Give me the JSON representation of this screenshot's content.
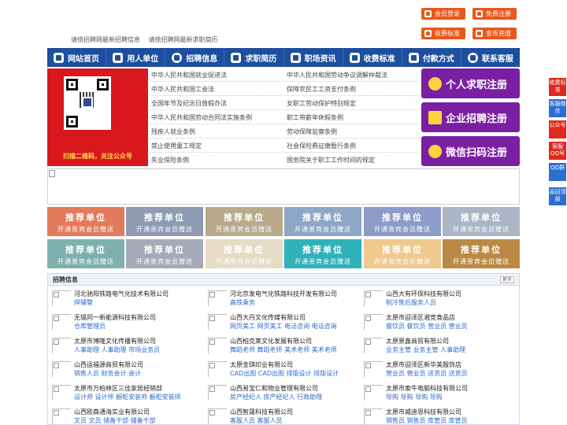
{
  "top": {
    "notices": [
      "请徐招聘网最新招聘信息",
      "请徐招聘网最新求职简历"
    ],
    "buttons": [
      {
        "label": "会员登录",
        "icon": "user-icon"
      },
      {
        "label": "免费注册",
        "icon": "register-icon"
      },
      {
        "label": "收费标准",
        "icon": "price-icon"
      },
      {
        "label": "金币充值",
        "icon": "coin-icon"
      }
    ]
  },
  "nav": [
    {
      "label": "网站首页",
      "icon": "home-icon"
    },
    {
      "label": "用人单位",
      "icon": "building-icon"
    },
    {
      "label": "招聘信息",
      "icon": "recruit-icon"
    },
    {
      "label": "求职简历",
      "icon": "resume-icon"
    },
    {
      "label": "职场资讯",
      "icon": "news-icon"
    },
    {
      "label": "收费标准",
      "icon": "price-icon"
    },
    {
      "label": "付款方式",
      "icon": "payment-icon"
    },
    {
      "label": "联系客服",
      "icon": "service-icon"
    }
  ],
  "qr": {
    "caption": "扫描二维码，关注公众号"
  },
  "links": {
    "left": [
      "中华人民共和国就业促进法",
      "中华人民共和国工会法",
      "全国年节及纪念日放假办法",
      "中华人民共和国劳动合同法实施条例",
      "残疾人就业条例",
      "禁止使用童工规定",
      "失业保险条例"
    ],
    "right": [
      "中华人民共和国劳动争议调解仲裁法",
      "保障农民工工资支付条例",
      "女职工劳动保护特别规定",
      "职工带薪年休假条例",
      "劳动保障监察条例",
      "社会保险费征缴暂行条例",
      "国务院关于职工工作时间的规定"
    ]
  },
  "register": [
    {
      "label": "个人求职注册",
      "icon": "person-icon"
    },
    {
      "label": "企业招聘注册",
      "icon": "company-icon"
    },
    {
      "label": "微信扫码注册",
      "icon": "wechat-icon"
    }
  ],
  "tiles": {
    "title": "推荐单位",
    "subtitle": "开通贵宾会员赠送",
    "colors": [
      "#e27b5b",
      "#8e9bb3",
      "#b9aa8c",
      "#8ea7c7",
      "#8d9bc8",
      "#aab6c6",
      "#7fb0b0",
      "#a5a9b9",
      "#e6dcc6",
      "#2fb2ba",
      "#f0c98f",
      "#ba8a44",
      "#b7b2a4"
    ]
  },
  "jobs": {
    "title": "招聘信息",
    "more": "更多",
    "items": [
      {
        "company": "河北驰阳铁路电气化技术有限公司",
        "positions": "焊辅警"
      },
      {
        "company": "河北京发电气化铁路科技开发有限公司",
        "positions": "高铁乘务"
      },
      {
        "company": "山西大有环保科技有限公司",
        "positions": "制冷售后服务人员"
      },
      {
        "company": "无锡同一新能源科技有限公司",
        "positions": "仓库管理员"
      },
      {
        "company": "山西大丹文化传媒有限公司",
        "positions": "网页美工 网页美工 电话咨询 电话咨询"
      },
      {
        "company": "太原市迎泽区湘竞食品店",
        "positions": "餐饮员 餐饮员 营业员 营业员"
      },
      {
        "company": "太原市博隆文化传播有限公司",
        "positions": "人事助理 人事助理 市场业务员"
      },
      {
        "company": "山西柏克莱文化发展有限公司",
        "positions": "舞蹈老师 舞蹈老师 美术老师 美术老师"
      },
      {
        "company": "太原景鑫商贸有限公司",
        "positions": "业务主管 业务主管 人事助理"
      },
      {
        "company": "山西运福源商贸有限公司",
        "positions": "销售人员 财务会计 会计"
      },
      {
        "company": "太原金琪印业有限公司",
        "positions": "CAD出图 CAD出图 排版设计 排版设计"
      },
      {
        "company": "太原市迎泽区新华美服饰店",
        "positions": "营业员 营业员 送货员 送货员"
      },
      {
        "company": "太原市万柏林区三佳家居经销部",
        "positions": "设计师 设计师 橱柜安装师 橱柜安装师"
      },
      {
        "company": "山西易宝仁和物业管理有限公司",
        "positions": "房产经纪人 房产经纪人 行政助理"
      },
      {
        "company": "太原市索牛电脑科技有限公司",
        "positions": "导购 导购 导购 导购"
      },
      {
        "company": "山西欧森通海实业有限公司",
        "positions": "文员 文员 储备干部 储备干部"
      },
      {
        "company": "山西智晟科技有限公司",
        "positions": "客服人员 客服人员"
      },
      {
        "company": "太原市威迪恩科技有限公司",
        "positions": "销售员 销售员 库管员 库管员"
      }
    ]
  },
  "float_bar": [
    "收费标准",
    "客服微信",
    "公众号",
    "客服QQ号",
    "QQ群",
    "返回顶部"
  ]
}
